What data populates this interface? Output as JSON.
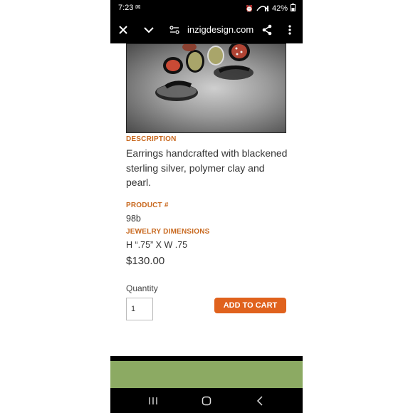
{
  "status_bar": {
    "time": "7:23",
    "battery": "42%"
  },
  "browser": {
    "url": "inzigdesign.com"
  },
  "product": {
    "description_label": "DESCRIPTION",
    "description": "Earrings handcrafted with blackened sterling silver, polymer clay and pearl.",
    "product_number_label": "PRODUCT #",
    "product_number": "98b",
    "dimensions_label": "JEWELRY DIMENSIONS",
    "dimensions": "H “.75” X W .75",
    "price": "$130.00",
    "quantity_label": "Quantity",
    "quantity_value": "1",
    "add_to_cart_label": "ADD TO CART"
  },
  "colors": {
    "accent": "#e0621d",
    "label": "#c8681e",
    "footer_green": "#8caa63"
  },
  "icons": [
    "close-icon",
    "chevron-down-icon",
    "page-settings-icon",
    "share-icon",
    "more-icon",
    "recents-icon",
    "home-icon",
    "back-icon"
  ]
}
